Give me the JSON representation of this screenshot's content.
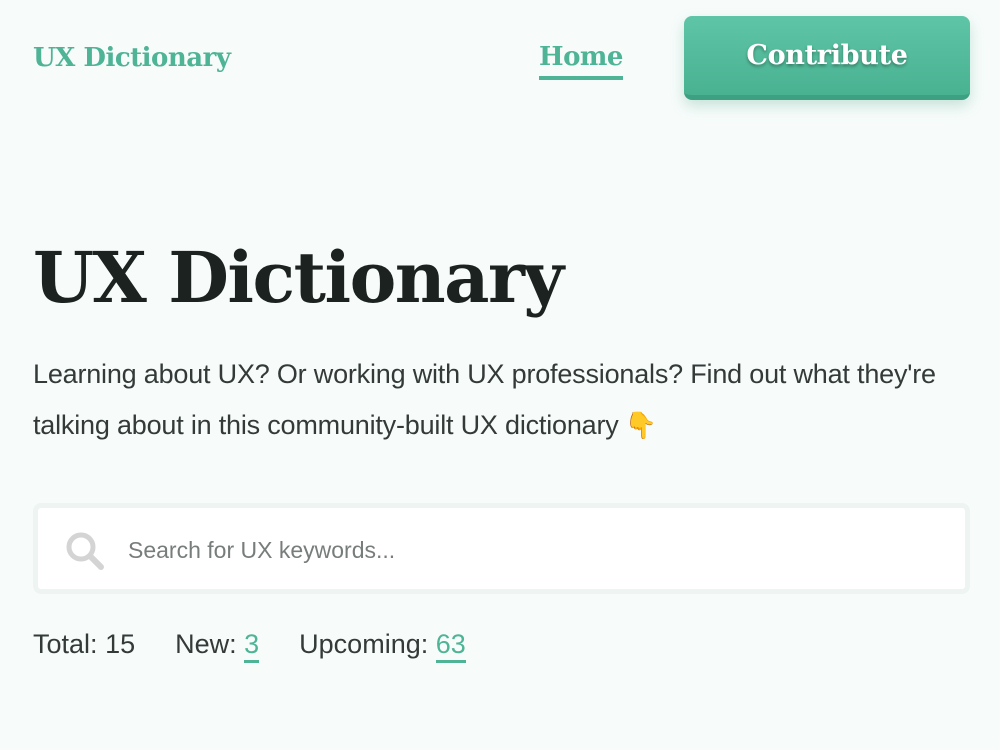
{
  "header": {
    "logo": "UX Dictionary",
    "nav_home": "Home",
    "contribute_label": "Contribute"
  },
  "hero": {
    "title": "UX Dictionary",
    "description": "Learning about UX? Or working with UX professionals? Find out what they're talking about in this community-built UX dictionary",
    "emoji": "👇"
  },
  "search": {
    "placeholder": "Search for UX keywords...",
    "icon": "search-icon"
  },
  "stats": {
    "total_label": "Total:",
    "total_value": "15",
    "new_label": "New:",
    "new_value": "3",
    "upcoming_label": "Upcoming:",
    "upcoming_value": "63"
  },
  "colors": {
    "accent": "#4fb396",
    "background": "#f7fcfb",
    "text": "#222a28"
  }
}
